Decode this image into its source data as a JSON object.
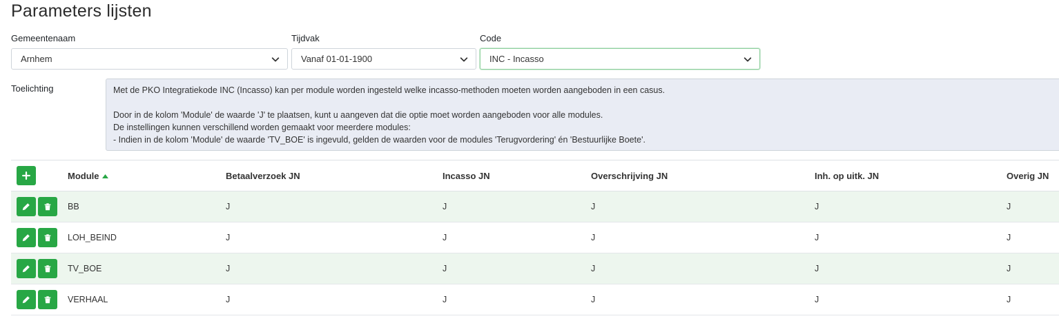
{
  "page": {
    "title": "Parameters lijsten"
  },
  "filters": {
    "gemeente": {
      "label": "Gemeentenaam",
      "value": "Arnhem"
    },
    "tijdvak": {
      "label": "Tijdvak",
      "value": "Vanaf 01-01-1900"
    },
    "code": {
      "label": "Code",
      "value": "INC - Incasso"
    }
  },
  "toelichting": {
    "label": "Toelichting",
    "lines": [
      "Met de PKO Integratiekode INC (Incasso) kan per module worden ingesteld welke incasso-methoden moeten worden aangeboden in een casus.",
      "",
      "Door in de kolom 'Module' de waarde 'J' te plaatsen, kunt u aangeven dat die optie moet worden aangeboden voor alle modules.",
      "De instellingen kunnen verschillend worden gemaakt voor meerdere modules:",
      "- Indien in de kolom 'Module' de waarde 'TV_BOE' is ingevuld, gelden de waarden voor de modules 'Terugvordering' én 'Bestuurlijke Boete'."
    ]
  },
  "table": {
    "columns": [
      "Module",
      "Betaalverzoek JN",
      "Incasso JN",
      "Overschrijving JN",
      "Inh. op uitk. JN",
      "Overig JN"
    ],
    "rows": [
      [
        "BB",
        "J",
        "J",
        "J",
        "J",
        "J"
      ],
      [
        "LOH_BEIND",
        "J",
        "J",
        "J",
        "J",
        "J"
      ],
      [
        "TV_BOE",
        "J",
        "J",
        "J",
        "J",
        "J"
      ],
      [
        "VERHAAL",
        "J",
        "J",
        "J",
        "J",
        "J"
      ]
    ],
    "sort": {
      "column": "Module",
      "direction": "asc"
    }
  },
  "icons": {
    "add": "plus-icon",
    "edit": "pencil-icon",
    "delete": "trash-icon",
    "select": "chevron-down-icon",
    "sort": "sort-asc-icon"
  },
  "colors": {
    "accent": "#28a745",
    "note_bg": "#e9ecf4",
    "row_alt": "#edf6ee"
  }
}
